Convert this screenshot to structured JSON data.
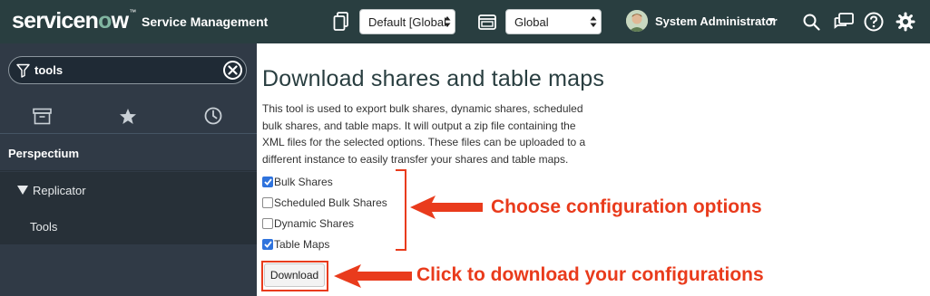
{
  "header": {
    "logo": {
      "pre": "servicen",
      "o": "o",
      "post": "w",
      "tm": "™"
    },
    "app_title": "Service Management",
    "update_set_select": "Default [Global",
    "scope_select": "Global",
    "user_name": "System Administrator",
    "icons": [
      "update-set-icon",
      "application-picker-icon",
      "search-icon",
      "connect-chat-icon",
      "help-icon",
      "settings-gear-icon"
    ]
  },
  "sidebar": {
    "filter": {
      "value": "tools",
      "icon": "filter-icon"
    },
    "tabs": [
      "all-applications-icon",
      "favorites-star-icon",
      "history-clock-icon"
    ],
    "application": "Perspectium",
    "module": "Replicator",
    "item": "Tools"
  },
  "main": {
    "title": "Download shares and table maps",
    "description": "This tool is used to export bulk shares, dynamic shares, scheduled bulk shares, and table maps. It will output a zip file containing the XML files for the selected options. These files can be uploaded to a different instance to easily transfer your shares and table maps.",
    "options": [
      {
        "label": "Bulk Shares",
        "checked": true
      },
      {
        "label": "Scheduled Bulk Shares",
        "checked": false
      },
      {
        "label": "Dynamic Shares",
        "checked": false
      },
      {
        "label": "Table Maps",
        "checked": true
      }
    ],
    "download_label": "Download"
  },
  "annotations": {
    "options_note": "Choose configuration options",
    "download_note": "Click to download your configurations",
    "color": "#e93b1c"
  },
  "colors": {
    "header_bg": "#293e40",
    "sidebar_bg": "#303a46",
    "accent_green": "#81b5a1",
    "checkbox_blue": "#2f73dd"
  }
}
